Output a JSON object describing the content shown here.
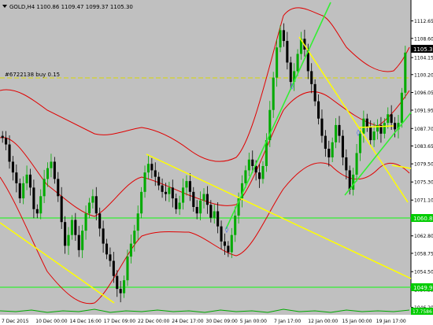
{
  "window": {
    "symbol_line": "GOLD,H4  1100.86 1109.47 1099.37 1105.30",
    "trade_label": "#6722138 buy 0.15",
    "current_price": "1105.30",
    "green_level_1": "1060.81",
    "green_level_2": "1049.95",
    "bottom_tag": "17.7586"
  },
  "colors": {
    "background": "#c0c0c0",
    "bull_candle": "#00aa00",
    "bear_candle": "#000000",
    "bollinger": "#e00000",
    "trendline_yellow": "#ffff00",
    "trendline_green": "#33ee33",
    "trade_line": "#d8d800",
    "price_tag_bg": "#000000",
    "level_tag_bg": "#00cc00"
  },
  "chart_data": {
    "type": "candlestick",
    "ylim": [
      1044.5,
      1117.5
    ],
    "y_ticks": [
      "1112.65",
      "1108.60",
      "1104.15",
      "1100.20",
      "1096.05",
      "1091.95",
      "1087.70",
      "1083.65",
      "1079.50",
      "1075.30",
      "1071.10",
      "1067.05",
      "1062.80",
      "1058.75",
      "1054.50",
      "1050.35",
      "1046.20"
    ],
    "x_labels": [
      "7 Dec 2015",
      "10 Dec 00:00",
      "14 Dec 16:00",
      "17 Dec 09:00",
      "22 Dec 00:00",
      "24 Dec 17:00",
      "30 Dec 09:00",
      "5 Jan 00:00",
      "7 Jan 17:00",
      "12 Jan 00:00",
      "15 Jan 00:00",
      "19 Jan 17:00"
    ],
    "series": [
      {
        "values": [
          1085.5,
          1084.0,
          1080.0,
          1077.5,
          1075.0,
          1071.5,
          1075.0,
          1077.0,
          1074.0,
          1069.0,
          1068.0,
          1072.0,
          1076.0,
          1078.5,
          1080.0,
          1076.0,
          1072.0,
          1066.0,
          1060.5,
          1063.0,
          1066.5,
          1063.0,
          1059.5,
          1064.0,
          1068.0,
          1070.5,
          1072.0,
          1068.0,
          1064.5,
          1061.0,
          1058.5,
          1057.0,
          1053.5,
          1050.5,
          1049.5,
          1052.5,
          1058.0,
          1061.0,
          1064.0,
          1068.0,
          1073.0,
          1077.5,
          1079.5,
          1078.0,
          1076.5,
          1074.5,
          1073.0,
          1072.5,
          1074.0,
          1071.5,
          1069.0,
          1070.5,
          1074.0,
          1075.5,
          1073.0,
          1069.5,
          1068.0,
          1071.0,
          1072.5,
          1070.0,
          1067.0,
          1068.5,
          1065.0,
          1061.5,
          1060.5,
          1059.0,
          1063.0,
          1067.5,
          1071.5,
          1075.0,
          1078.0,
          1080.5,
          1079.0,
          1077.5,
          1076.0,
          1079.0,
          1085.0,
          1092.0,
          1099.5,
          1106.5,
          1110.5,
          1108.0,
          1103.0,
          1098.5,
          1101.0,
          1105.0,
          1108.5,
          1106.0,
          1101.0,
          1098.0,
          1094.0,
          1090.0,
          1086.0,
          1083.0,
          1081.0,
          1084.5,
          1088.5,
          1086.0,
          1081.0,
          1078.0,
          1073.5,
          1077.0,
          1082.0,
          1086.5,
          1090.0,
          1088.0,
          1085.0,
          1087.0,
          1088.5,
          1086.5,
          1089.0,
          1091.0,
          1089.0,
          1087.5,
          1089.0,
          1096.0,
          1105.3
        ]
      }
    ]
  }
}
